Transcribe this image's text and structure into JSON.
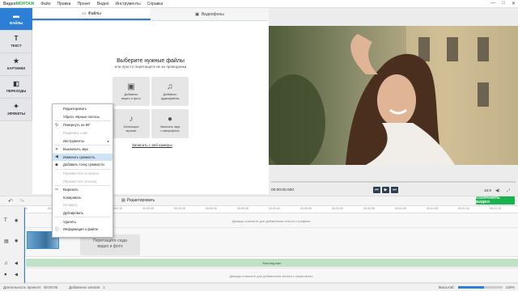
{
  "app": {
    "logo_prefix": "Видео",
    "logo_suffix": "МОНТАЖ"
  },
  "menu": [
    "Файл",
    "Правка",
    "Проект",
    "Видео",
    "Инструменты",
    "Справка"
  ],
  "sidebar": [
    {
      "label": "ФАЙЛЫ",
      "icon": "folder-icon",
      "active": true
    },
    {
      "label": "ТЕКСТ",
      "icon": "text-icon",
      "active": false
    },
    {
      "label": "КАРТИНКИ",
      "icon": "star-icon",
      "active": false
    },
    {
      "label": "ПЕРЕХОДЫ",
      "icon": "transitions-icon",
      "active": false
    },
    {
      "label": "ЭФФЕКТЫ",
      "icon": "wand-icon",
      "active": false
    }
  ],
  "tabs": [
    {
      "label": "Файлы",
      "active": true
    },
    {
      "label": "Видеофоны",
      "active": false
    }
  ],
  "files": {
    "heading": "Выберите нужные файлы",
    "subheading": "или просто перетащите их из проводника",
    "tiles": [
      {
        "line1": "Добавить",
        "line2": "видео и фото",
        "icon": "video-add-icon"
      },
      {
        "line1": "Добавить",
        "line2": "аудиофайлы",
        "icon": "audio-file-icon"
      },
      {
        "line1": "Коллекция",
        "line2": "музыки",
        "icon": "music-note-icon"
      },
      {
        "line1": "Записать звук",
        "line2": "с микрофона",
        "icon": "microphone-icon"
      }
    ],
    "webcam_link": "Записать с веб-камеры"
  },
  "preview": {
    "time": "00:00:00.000",
    "aspect": "16:9"
  },
  "editbar": {
    "edit_label": "Редактировать",
    "save_label": "СОХРАНИТЬ ВИДЕО"
  },
  "timeline": {
    "ticks": [
      "00:00:00",
      "00:00:05",
      "00:00:10",
      "00:00:15",
      "00:00:20",
      "00:00:25",
      "00:00:30",
      "00:00:35",
      "00:00:40",
      "00:00:45",
      "00:00:50",
      "00:00:55",
      "00:01:00",
      "00:01:05",
      "00:01:10",
      "00:01:15"
    ],
    "text_hint": "Дважды кликните для добавления текста и графики",
    "drop_hint_line1": "Перетащите сюда",
    "drop_hint_line2": "видео и фото",
    "music_label": "Morning.wav",
    "voice_hint": "Дважды кликните для добавления записи с микрофона"
  },
  "status": {
    "duration_label": "Длительность проекта:",
    "duration_value": "00:00:06",
    "clips_label": "Добавлено клипов:",
    "clips_value": "1",
    "zoom_label": "Масштаб:",
    "zoom_value": "100%"
  },
  "context_menu": [
    {
      "label": "Редактировать",
      "icon": "",
      "disabled": false
    },
    {
      "label": "Убрать чёрные полосы",
      "icon": "",
      "disabled": false
    },
    {
      "label": "Повернуть на 90°",
      "icon": "rotate-icon",
      "disabled": false
    },
    {
      "label": "Разделить клип",
      "icon": "",
      "disabled": true
    },
    {
      "label": "Инструменты",
      "icon": "",
      "disabled": false,
      "submenu": true
    },
    {
      "label": "Выключить звук",
      "icon": "mute-icon",
      "disabled": false
    },
    {
      "label": "Изменить громкость",
      "icon": "volume-icon",
      "disabled": false,
      "highlight": true
    },
    {
      "label": "Добавить точку громкости",
      "icon": "volume-point-icon",
      "disabled": false
    },
    {
      "label": "Переместить в начало",
      "icon": "",
      "disabled": true
    },
    {
      "label": "Переместить в конец",
      "icon": "",
      "disabled": true
    },
    {
      "label": "Вырезать",
      "icon": "cut-icon",
      "disabled": false
    },
    {
      "label": "Копировать",
      "icon": "",
      "disabled": false
    },
    {
      "label": "Вставить",
      "icon": "",
      "disabled": true
    },
    {
      "label": "Дублировать",
      "icon": "",
      "disabled": false
    },
    {
      "label": "Удалить",
      "icon": "",
      "disabled": false
    },
    {
      "label": "Информация о файле",
      "icon": "info-icon",
      "disabled": false
    }
  ],
  "colors": {
    "accent": "#2d7fd6",
    "save": "#19b34e"
  }
}
